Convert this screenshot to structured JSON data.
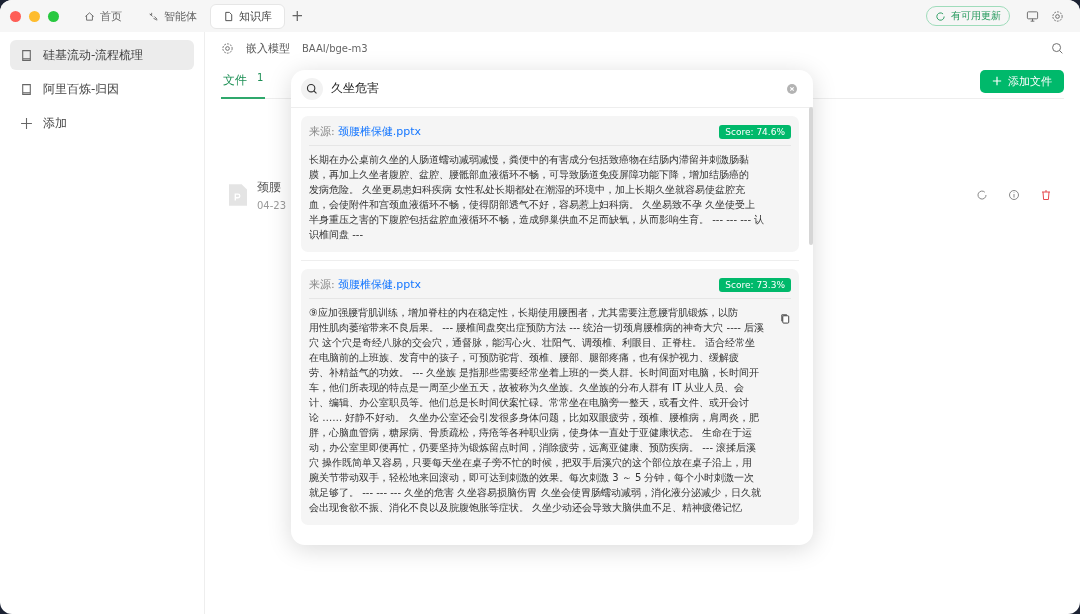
{
  "titlebar": {
    "tabs": [
      {
        "label": "首页",
        "selected": false
      },
      {
        "label": "智能体",
        "selected": false
      },
      {
        "label": "知识库",
        "selected": true
      }
    ],
    "new_tab": "+",
    "update": "有可用更新"
  },
  "sidebar": {
    "items": [
      {
        "label": "硅基流动-流程梳理",
        "selected": true
      },
      {
        "label": "阿里百炼-归因",
        "selected": false
      }
    ],
    "add": "添加"
  },
  "main": {
    "model_label": "嵌入模型",
    "model_value": "BAAI/bge-m3",
    "tabs": [
      {
        "label": "文件",
        "count": "1",
        "selected": true
      }
    ],
    "add_button": "添加文件",
    "files": [
      {
        "name": "颈腰",
        "date": "04-23"
      }
    ]
  },
  "search_dialog": {
    "query": "久坐危害",
    "results": [
      {
        "source_label": "来源:",
        "source": "颈腰椎保健.pptx",
        "score": "Score: 74.6%",
        "copy_icon": false,
        "lines": [
          "长期在办公桌前久坐的人肠道蠕动减弱减慢，粪便中的有害成分包括致癌物在结肠内滞留并刺激肠黏",
          "膜，再加上久坐者腹腔、盆腔、腰骶部血液循环不畅，可导致肠道免疫屏障功能下降，增加结肠癌的",
          "发病危险。 久坐更易患妇科疾病 女性私处长期都处在潮湿的环境中，加上长期久坐就容易使盆腔充",
          "血，会使附件和宫颈血液循环不畅，使得阴部透气不好，容易惹上妇科病。 久坐易致不孕 久坐使受上",
          "半身重压之害的下腹腔包括盆腔血液循环不畅，造成卵巢供血不足而缺氧，从而影响生育。 --- --- --- 认",
          "识椎间盘 ---"
        ]
      },
      {
        "source_label": "来源:",
        "source": "颈腰椎保健.pptx",
        "score": "Score: 73.3%",
        "copy_icon": true,
        "lines": [
          "⑨应加强腰背肌训练，增加脊柱的内在稳定性，长期使用腰围者，尤其需要注意腰背肌锻炼，以防",
          "用性肌肉萎缩带来不良后果。 --- 腰椎间盘突出症预防方法 --- 统治一切颈肩腰椎病的神奇大穴 ---- 后溪",
          "穴 这个穴是奇经八脉的交会穴，通督脉，能泻心火、壮阳气、调颈椎、利眼目、正脊柱。 适合经常坐",
          "在电脑前的上班族、发育中的孩子，可预防驼背、颈椎、腰部、腿部疼痛，也有保护视力、缓解疲",
          "劳、补精益气的功效。 --- 久坐族 是指那些需要经常坐着上班的一类人群。长时间面对电脑，长时间开",
          "车，他们所表现的特点是一周至少坐五天，故被称为久坐族。久坐族的分布人群有 IT 从业人员、会",
          "计、编辑、办公室职员等。他们总是长时间伏案忙碌。常常坐在电脑旁一整天，或看文件、或开会讨",
          "论 …… 好静不好动。 久坐办公室还会引发很多身体问题，比如双眼疲劳，颈椎、腰椎病，肩周炎，肥",
          "胖，心脑血管病，糖尿病、骨质疏松，痔疮等各种职业病，使身体一直处于亚健康状态。 生命在于运",
          "动，办公室里即便再忙，仍要坚持为锻炼留点时间，消除疲劳，远离亚健康、预防疾病。 --- 滚揉后溪",
          "穴 操作既简单又容易，只要每天坐在桌子旁不忙的时候，把双手后溪穴的这个部位放在桌子沿上，用",
          "腕关节带动双手，轻松地来回滚动，即可达到刺激的效果。每次刺激 3 ～ 5 分钟，每个小时刺激一次",
          "就足够了。 --- --- --- 久坐的危害 久坐容易损脑伤胃 久坐会使胃肠蠕动减弱，消化液分泌减少，日久就",
          "会出现食欲不振、消化不良以及脘腹饱胀等症状。 久坐少动还会导致大脑供血不足、精神疲倦记忆"
        ]
      }
    ]
  }
}
